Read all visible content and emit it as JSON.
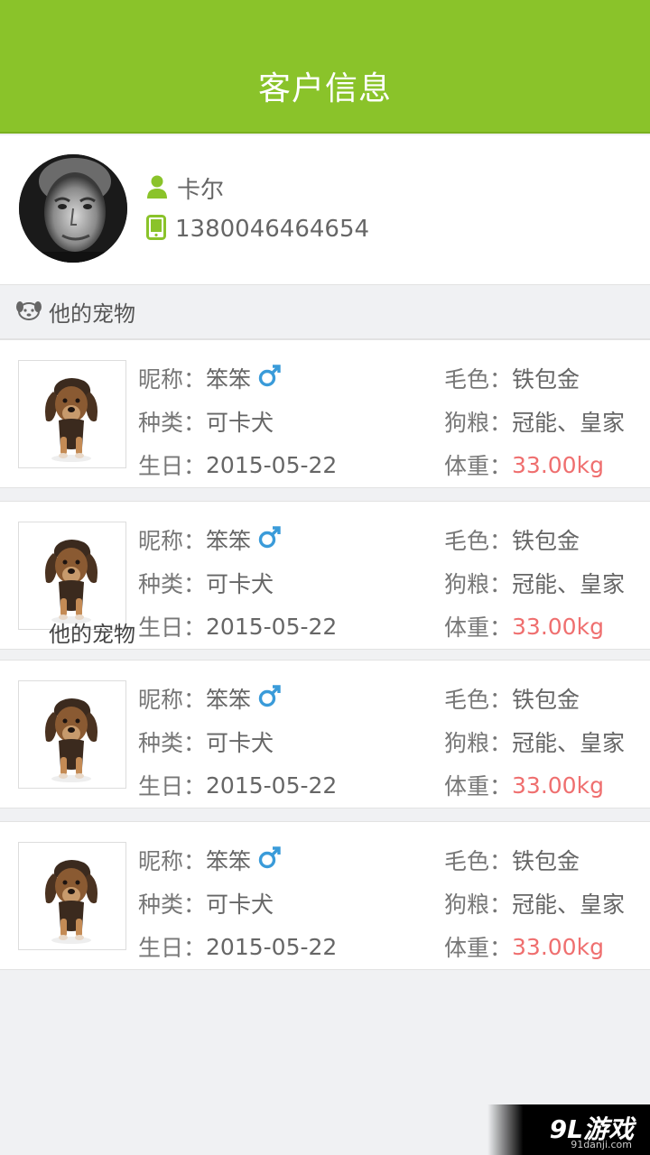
{
  "header": {
    "title": "客户信息"
  },
  "profile": {
    "name": "卡尔",
    "phone": "1380046464654",
    "icons": {
      "name": "user-icon",
      "phone": "phone-icon"
    }
  },
  "pets_section": {
    "title": "他的宠物",
    "icon": "pet-face-icon"
  },
  "labels": {
    "nickname": "昵称：",
    "breed": "种类：",
    "birthday": "生日：",
    "fur": "毛色：",
    "food": "狗粮：",
    "weight": "体重："
  },
  "pets": [
    {
      "nickname": "笨笨",
      "gender": "male",
      "breed": "可卡犬",
      "birthday": "2015-05-22",
      "fur": "铁包金",
      "food": "冠能、皇家",
      "weight": "33.00kg"
    },
    {
      "nickname": "笨笨",
      "gender": "male",
      "breed": "可卡犬",
      "birthday": "2015-05-22",
      "fur": "铁包金",
      "food": "冠能、皇家",
      "weight": "33.00kg"
    },
    {
      "nickname": "笨笨",
      "gender": "male",
      "breed": "可卡犬",
      "birthday": "2015-05-22",
      "fur": "铁包金",
      "food": "冠能、皇家",
      "weight": "33.00kg"
    },
    {
      "nickname": "笨笨",
      "gender": "male",
      "breed": "可卡犬",
      "birthday": "2015-05-22",
      "fur": "铁包金",
      "food": "冠能、皇家",
      "weight": "33.00kg"
    }
  ],
  "overlay_text": "他的宠物",
  "watermark": {
    "brand": "9L游戏",
    "site": "91danji.com"
  },
  "colors": {
    "header": "#8ac32a",
    "accent_green": "#8ac32a",
    "weight_red": "#ef6f6f",
    "male_blue": "#3a9bd9"
  }
}
